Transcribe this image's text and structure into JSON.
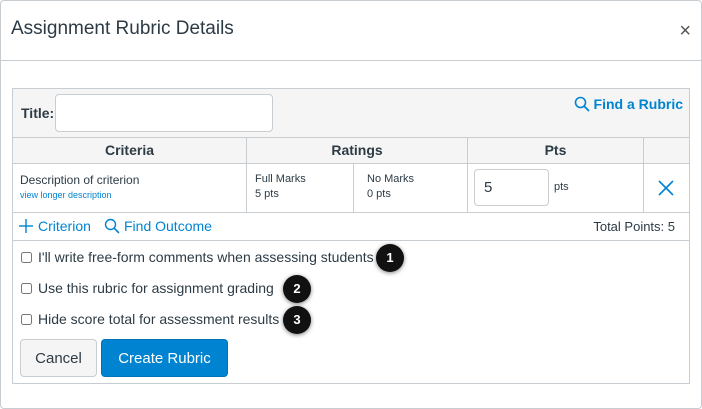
{
  "dialog": {
    "title": "Assignment Rubric Details",
    "close_glyph": "×"
  },
  "rubric": {
    "title_label": "Title:",
    "title_value": "",
    "find_rubric_label": "Find a Rubric"
  },
  "table": {
    "headers": {
      "criteria": "Criteria",
      "ratings": "Ratings",
      "pts": "Pts"
    },
    "row": {
      "description": "Description of criterion",
      "long_desc_link": "view longer description",
      "ratings": [
        {
          "label": "Full Marks",
          "points": "5 pts"
        },
        {
          "label": "No Marks",
          "points": "0 pts"
        }
      ],
      "points_value": "5",
      "points_suffix": "pts"
    }
  },
  "footer": {
    "add_criterion": "Criterion",
    "find_outcome": "Find Outcome",
    "total_points": "Total Points: 5"
  },
  "options": [
    {
      "label": "I'll write free-form comments when assessing students",
      "checked": false,
      "badge": "1"
    },
    {
      "label": "Use this rubric for assignment grading",
      "checked": false,
      "badge": "2"
    },
    {
      "label": "Hide score total for assessment results",
      "checked": false,
      "badge": "3"
    }
  ],
  "buttons": {
    "cancel": "Cancel",
    "create": "Create Rubric"
  },
  "colors": {
    "accent": "#0084d1",
    "border": "#c7cdd1",
    "header_bg": "#f5f5f5",
    "text": "#2d3b45",
    "badge": "#111111"
  },
  "icons": {
    "close": "close-icon",
    "search": "search-icon",
    "plus": "plus-icon",
    "delete": "x-icon"
  }
}
